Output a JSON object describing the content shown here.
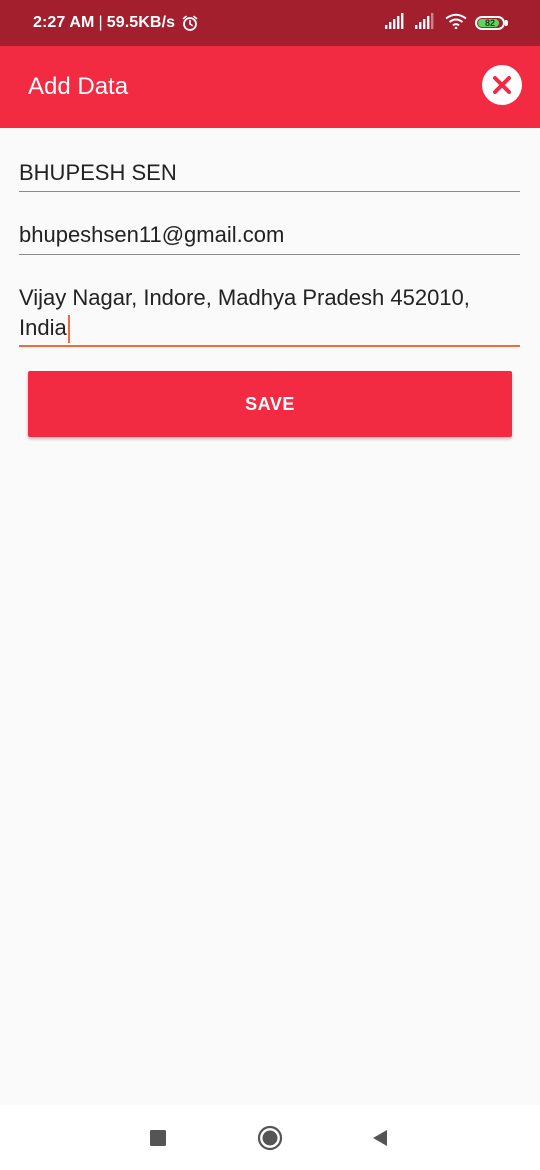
{
  "status_bar": {
    "time": "2:27 AM",
    "separator": "|",
    "net_speed": "59.5KB/s",
    "battery_level": "82",
    "icons": [
      "alarm-icon",
      "signal-icon",
      "signal-icon",
      "wifi-icon",
      "battery-icon"
    ]
  },
  "app_bar": {
    "title": "Add Data",
    "close_icon": "close-icon",
    "color": "#f22a42"
  },
  "form": {
    "name_value": "BHUPESH SEN",
    "email_value": "bhupeshsen11@gmail.com",
    "address_value": "Vijay Nagar, Indore, Madhya Pradesh 452010, India",
    "save_label": "SAVE"
  },
  "nav_bar": {
    "icons": [
      "recent-apps-icon",
      "home-icon",
      "back-icon"
    ]
  },
  "colors": {
    "status_bar": "#a31f2e",
    "accent": "#f22a42",
    "focus_underline": "#f06a3c",
    "background": "#fafafa"
  }
}
